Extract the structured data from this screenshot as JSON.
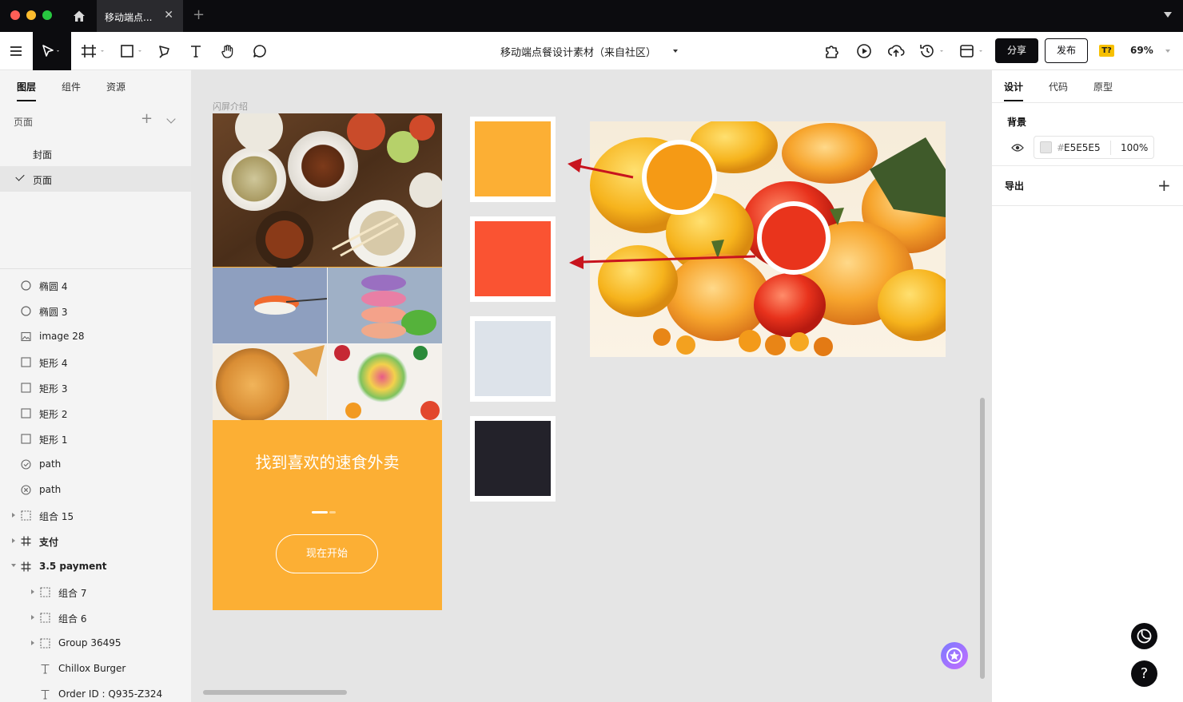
{
  "titlebar": {
    "tab_title": "移动端点...",
    "close_glyph": "✕",
    "new_tab_glyph": "+"
  },
  "toolbar": {
    "doc_title": "移动端点餐设计素材（来自社区）",
    "share_label": "分享",
    "publish_label": "发布",
    "badge_label": "T?",
    "zoom": "69%"
  },
  "left_panel": {
    "tabs": [
      "图层",
      "组件",
      "资源"
    ],
    "pages_header": "页面",
    "add_glyph": "+",
    "pages": [
      {
        "label": "封面",
        "selected": false
      },
      {
        "label": "页面",
        "selected": true
      }
    ],
    "layers": [
      {
        "label": "椭圆 4",
        "icon": "ellipse-icon"
      },
      {
        "label": "椭圆 3",
        "icon": "ellipse-icon"
      },
      {
        "label": "image 28",
        "icon": "image-icon"
      },
      {
        "label": "矩形 4",
        "icon": "rectangle-icon"
      },
      {
        "label": "矩形 3",
        "icon": "rectangle-icon"
      },
      {
        "label": "矩形 2",
        "icon": "rectangle-icon"
      },
      {
        "label": "矩形 1",
        "icon": "rectangle-icon"
      },
      {
        "label": "path",
        "icon": "path-check-icon"
      },
      {
        "label": "path",
        "icon": "path-x-icon"
      },
      {
        "label": "组合 15",
        "icon": "group-icon",
        "expand": "collapsed"
      },
      {
        "label": "支付",
        "icon": "frame-icon",
        "expand": "collapsed",
        "bold": true
      },
      {
        "label": "3.5 payment",
        "icon": "frame-icon",
        "expand": "expanded",
        "bold": true
      },
      {
        "label": "组合 7",
        "icon": "group-icon",
        "expand": "collapsed",
        "child": true
      },
      {
        "label": "组合 6",
        "icon": "group-icon",
        "expand": "collapsed",
        "child": true
      },
      {
        "label": "Group 36495",
        "icon": "group-icon",
        "expand": "collapsed",
        "child": true
      },
      {
        "label": "Chillox Burger",
        "icon": "text-icon",
        "child": true
      },
      {
        "label": "Order ID : Q935-Z324",
        "icon": "text-icon",
        "child": true
      }
    ]
  },
  "canvas": {
    "frame_label": "闪屏介绍",
    "phone": {
      "headline": "找到喜欢的速食外卖",
      "button_label": "现在开始",
      "background": "#FCAF34"
    },
    "swatches": [
      {
        "name": "orange",
        "color": "#FCAF34"
      },
      {
        "name": "red-orange",
        "color": "#FA5332"
      },
      {
        "name": "light-gray",
        "color": "#DDE3EA"
      },
      {
        "name": "dark",
        "color": "#23222A"
      }
    ],
    "arrow_color": "#C8141E"
  },
  "right_panel": {
    "tabs": [
      "设计",
      "代码",
      "原型"
    ],
    "background_label": "背景",
    "background_hash": "#",
    "background_hex": "E5E5E5",
    "background_opacity": "100%",
    "export_label": "导出",
    "add_glyph": "+",
    "help_glyph": "?"
  }
}
